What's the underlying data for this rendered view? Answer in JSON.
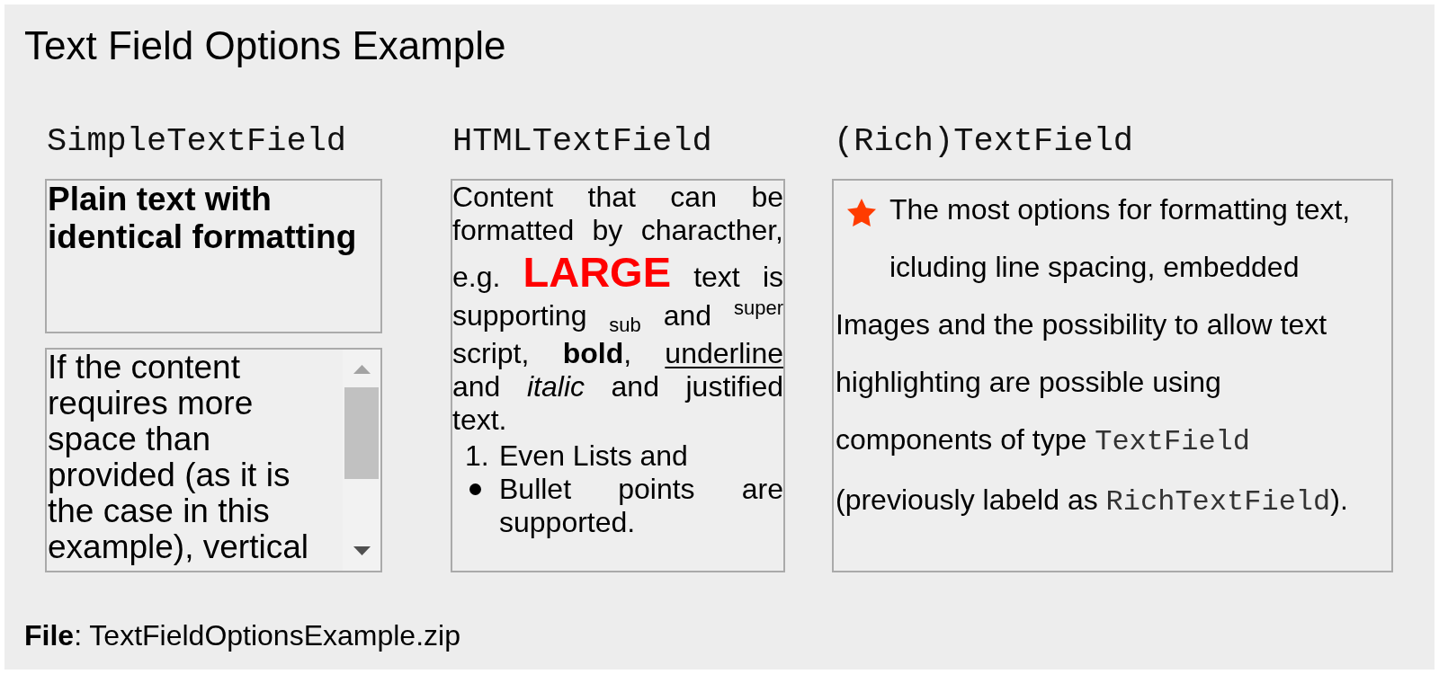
{
  "title": "Text Field Options Example",
  "columns": [
    {
      "heading": "SimpleTextField",
      "fields": [
        {
          "kind": "plain",
          "text": "Plain text with identical formatting"
        },
        {
          "kind": "scrolling",
          "text": "If the content requires more space than provided (as it is the case in this example), vertical"
        }
      ]
    },
    {
      "heading": "HTMLTextField",
      "fields": [
        {
          "kind": "html",
          "segments": [
            {
              "kind": "text",
              "text": "Content that can be formatted by characther, e.g. "
            },
            {
              "kind": "large",
              "text": "LARGE"
            },
            {
              "kind": "text",
              "text": " text is supporting $_{sub}$ and $^{super}$ script, **bold**, "
            },
            {
              "kind": "underline",
              "text": "underline"
            },
            {
              "kind": "text",
              "text": " and *italic* and justified text."
            }
          ],
          "list": [
            {
              "kind": "numbered",
              "marker": "1.",
              "text": "Even Lists and"
            },
            {
              "kind": "bullet",
              "text": "Bullet points are supported."
            }
          ]
        }
      ]
    },
    {
      "heading": "(Rich)TextField",
      "fields": [
        {
          "kind": "rich",
          "paragraphs": [
            {
              "kind": "beside_image",
              "segments": [
                {
                  "kind": "text",
                  "text": "The most options for formatting text, icluding line spacing, embedded"
                }
              ]
            },
            {
              "kind": "full_width",
              "segments": [
                {
                  "kind": "text",
                  "text": "Images and the possibility to allow text highlighting are possible using components of type "
                },
                {
                  "kind": "code",
                  "text": "TextField"
                },
                {
                  "kind": "text",
                  "text": " (previously labeld as "
                },
                {
                  "kind": "code",
                  "text": "RichTextField"
                },
                {
                  "kind": "text",
                  "text": ")."
                }
              ]
            }
          ]
        }
      ]
    }
  ],
  "file_caption": "**File**: TextFieldOptionsExample.zip"
}
